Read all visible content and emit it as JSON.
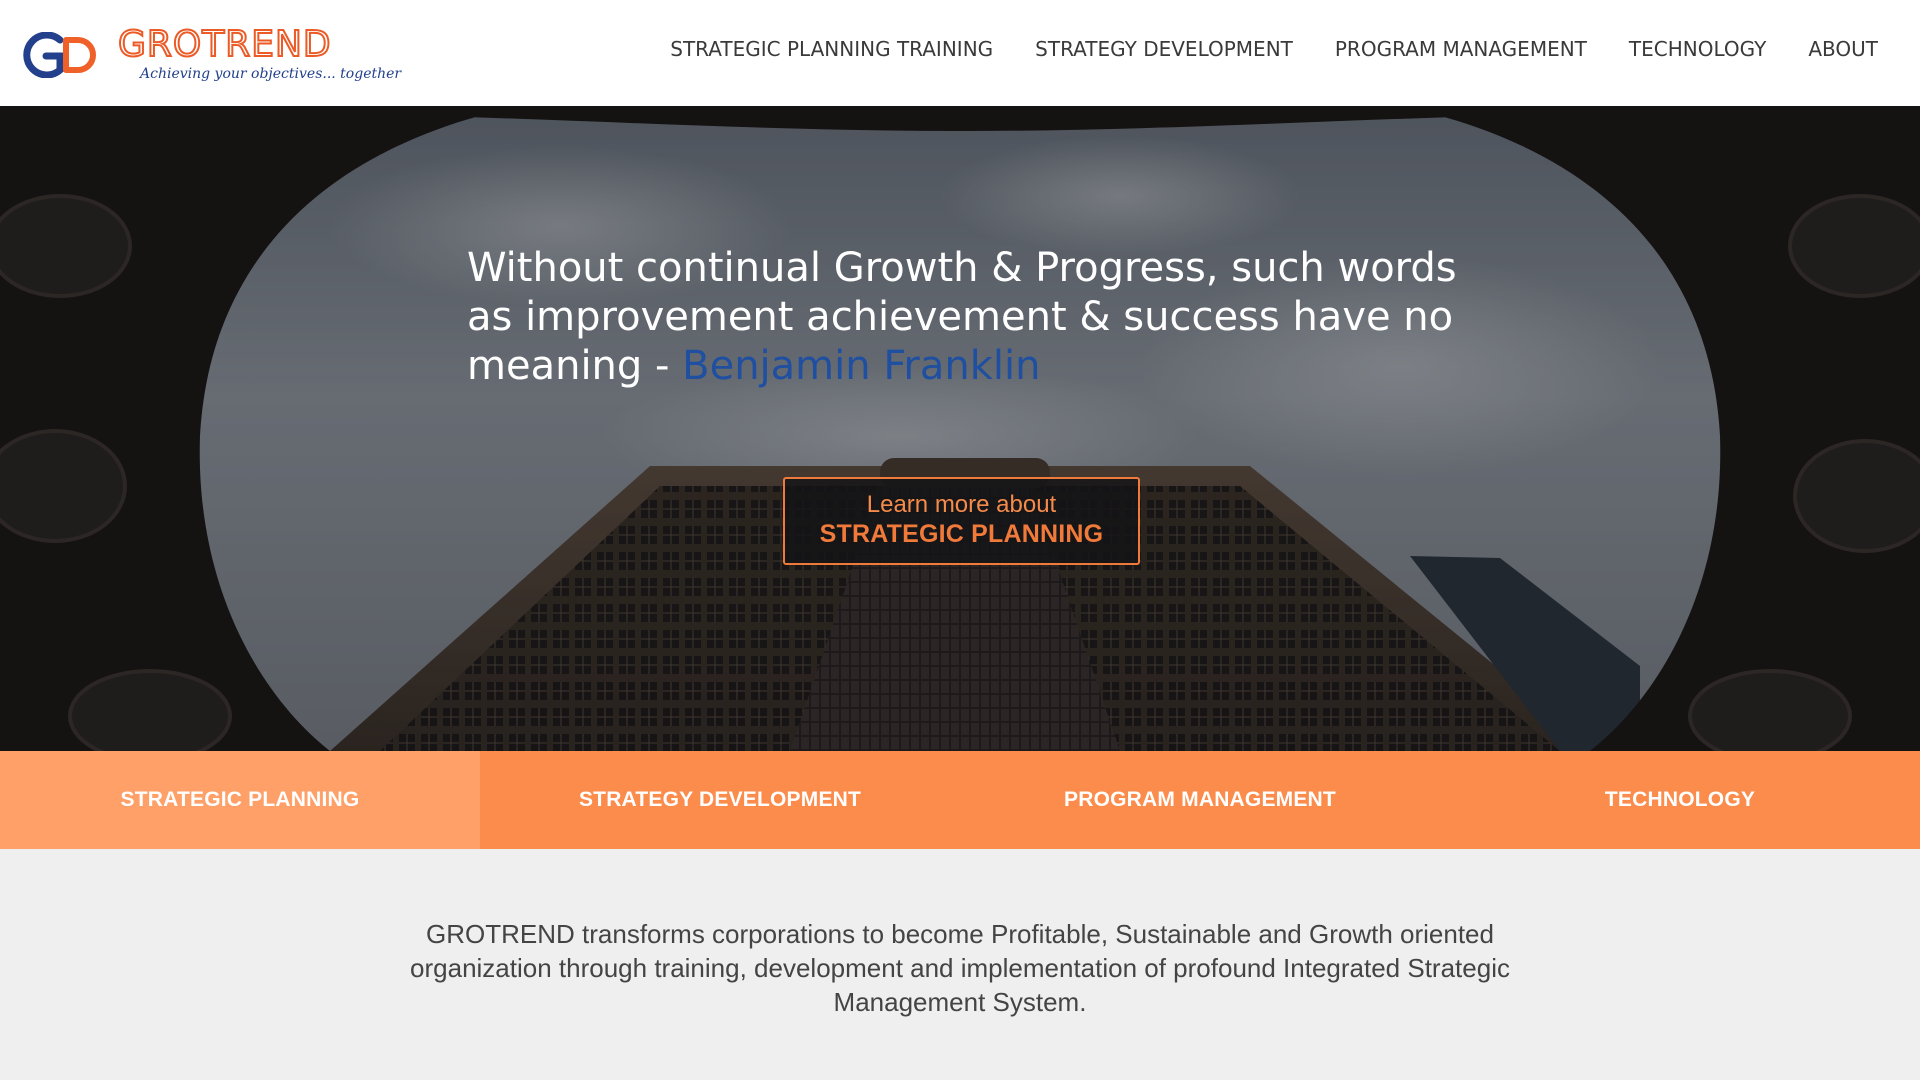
{
  "brand": {
    "name": "GROTREND",
    "tagline": "Achieving your objectives... together",
    "colors": {
      "orange": "#f0612a",
      "navy": "#22408c",
      "accent": "#fc8c4c"
    }
  },
  "nav": {
    "items": [
      {
        "label": "STRATEGIC PLANNING TRAINING"
      },
      {
        "label": "STRATEGY DEVELOPMENT"
      },
      {
        "label": "PROGRAM MANAGEMENT"
      },
      {
        "label": "TECHNOLOGY"
      },
      {
        "label": "ABOUT"
      }
    ]
  },
  "hero": {
    "quote_text": "Without continual Growth & Progress, such words as improvement achievement & success have no meaning - ",
    "quote_author": "Benjamin Franklin",
    "cta_line1": "Learn more about",
    "cta_line2": "STRATEGIC PLANNING"
  },
  "services": {
    "tabs": [
      {
        "label": "STRATEGIC PLANNING",
        "active": true
      },
      {
        "label": "STRATEGY DEVELOPMENT",
        "active": false
      },
      {
        "label": "PROGRAM MANAGEMENT",
        "active": false
      },
      {
        "label": "TECHNOLOGY",
        "active": false
      }
    ]
  },
  "intro": {
    "text": "GROTREND transforms corporations to become Profitable, Sustainable and Growth oriented organization through training, development and implementation of profound Integrated Strategic Management System."
  }
}
